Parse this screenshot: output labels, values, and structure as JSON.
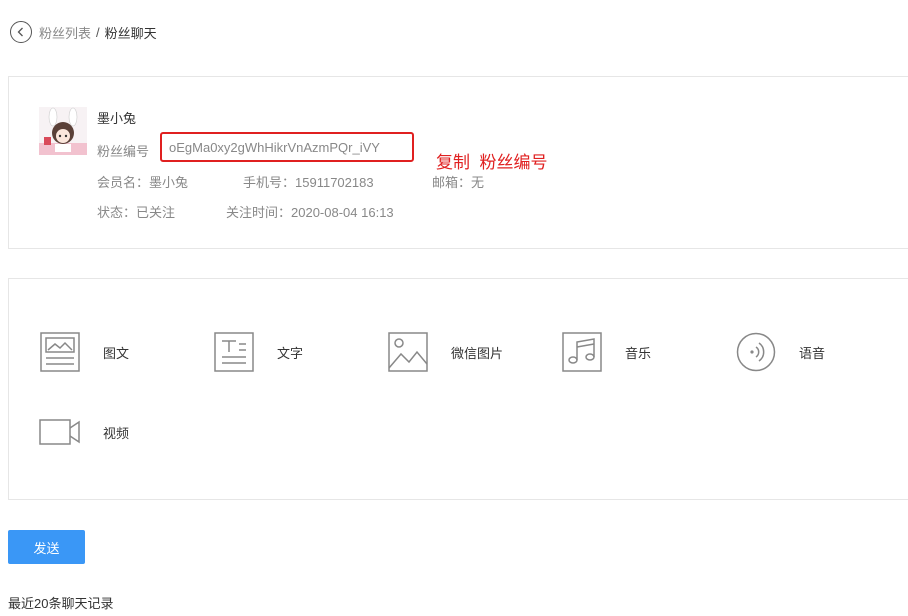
{
  "breadcrumb": {
    "parent": "粉丝列表",
    "separator": "/",
    "current": "粉丝聊天"
  },
  "user": {
    "name": "墨小兔",
    "fan_id_label": "粉丝编号",
    "fan_id": "oEgMa0xy2gWhHikrVnAzmPQr_iVY",
    "copy_note": "复制  粉丝编号",
    "member_label": "会员名：",
    "member_name": "墨小兔",
    "phone_label": "手机号：",
    "phone": "15911702183",
    "email_label": "邮箱：",
    "email": "无",
    "status_label": "状态：",
    "status": "已关注",
    "follow_time_label": "关注时间：",
    "follow_time": "2020-08-04 16:13"
  },
  "message_types": [
    {
      "label": "图文",
      "icon": "news-icon"
    },
    {
      "label": "文字",
      "icon": "text-icon"
    },
    {
      "label": "微信图片",
      "icon": "image-icon"
    },
    {
      "label": "音乐",
      "icon": "music-icon"
    },
    {
      "label": "语音",
      "icon": "voice-icon"
    },
    {
      "label": "视频",
      "icon": "video-icon"
    }
  ],
  "send_label": "发送",
  "recent_title": "最近20条聊天记录",
  "colors": {
    "accent": "#3a97f6",
    "highlight": "#e02020",
    "icon": "#888888"
  }
}
